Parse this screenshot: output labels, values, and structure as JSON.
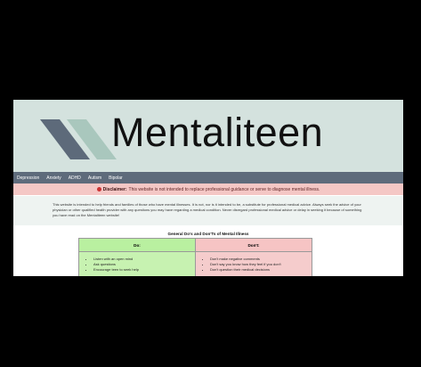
{
  "site": {
    "brand": "Mentaliteen"
  },
  "nav": {
    "items": [
      "Depression",
      "Anxiety",
      "ADHD",
      "Autism",
      "Bipolar"
    ]
  },
  "disclaimer": {
    "label": "Disclaimer:",
    "text": "This website is not intended to replace professional guidance or serve to diagnose mental illness."
  },
  "intro": {
    "text": "This website is intended to help friends and families of those who have mental illnesses. It is not, nor is it intended to be, a substitute for professional medical advice. Always seek the advice of your physician or other qualified health provider with any questions you may have regarding a medical condition. Never disregard professional medical advice or delay in seeking it because of something you have read on the Mentaliteen website!"
  },
  "table": {
    "title": "General Do's and Don'Ts of Mental Illness",
    "do_header": "Do:",
    "dont_header": "Don't:",
    "dos": [
      "Listen with an open mind",
      "Ask questions",
      "Encourage teen to seek help"
    ],
    "donts": [
      "Don't make negative comments",
      "Don't say you know how they feel if you don't",
      "Don't question their medical decisions"
    ]
  },
  "colors": {
    "banner_bg": "#d4e2de",
    "nav_bg": "#5e6b7b",
    "disclaimer_bg": "#f4c7c5",
    "do_bg": "#c7f2b1",
    "dont_bg": "#f5cccc",
    "logo_dark": "#5d6a7a",
    "logo_light": "#a9c7bd"
  }
}
